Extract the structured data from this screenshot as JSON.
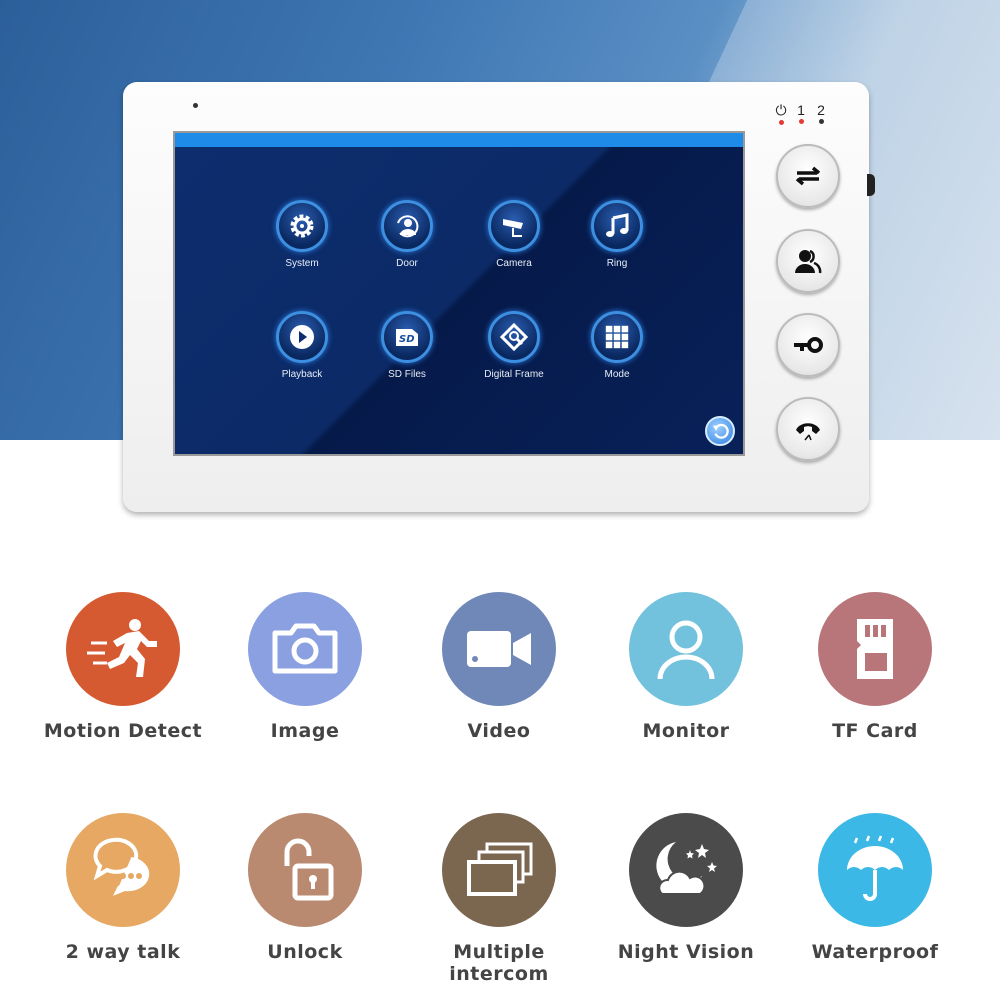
{
  "device": {
    "screen": {
      "apps": [
        {
          "label": "System",
          "icon": "gear-icon"
        },
        {
          "label": "Door",
          "icon": "door-user-icon"
        },
        {
          "label": "Camera",
          "icon": "cctv-camera-icon"
        },
        {
          "label": "Ring",
          "icon": "music-note-icon"
        },
        {
          "label": "Playback",
          "icon": "play-icon"
        },
        {
          "label": "SD Files",
          "icon": "sd-card-icon"
        },
        {
          "label": "Digital Frame",
          "icon": "picture-search-icon"
        },
        {
          "label": "Mode",
          "icon": "grid-icon"
        }
      ],
      "back_icon": "back-icon"
    },
    "indicators": [
      {
        "label": "⏻",
        "color": "#e53935"
      },
      {
        "label": "1",
        "color": "#e53935"
      },
      {
        "label": "2",
        "color": "#333333"
      }
    ],
    "buttons": [
      {
        "icon": "switch-arrows-icon"
      },
      {
        "icon": "monitor-users-icon"
      },
      {
        "icon": "unlock-key-icon"
      },
      {
        "icon": "hang-up-phone-icon"
      }
    ]
  },
  "features": [
    {
      "label": "Motion Detect",
      "color": "#d65a31",
      "icon": "running-man-icon"
    },
    {
      "label": "Image",
      "color": "#8ba0e0",
      "icon": "camera-icon"
    },
    {
      "label": "Video",
      "color": "#7088b8",
      "icon": "video-camera-icon"
    },
    {
      "label": "Monitor",
      "color": "#72c2dd",
      "icon": "person-icon"
    },
    {
      "label": "TF Card",
      "color": "#b8767a",
      "icon": "tf-card-icon"
    },
    {
      "label": "2 way talk",
      "color": "#e6a862",
      "icon": "chat-bubbles-icon"
    },
    {
      "label": "Unlock",
      "color": "#b98a70",
      "icon": "open-padlock-icon"
    },
    {
      "label": "Multiple intercom",
      "color": "#7b6650",
      "icon": "stacked-screens-icon"
    },
    {
      "label": "Night Vision",
      "color": "#4b4b4b",
      "icon": "moon-stars-icon"
    },
    {
      "label": "Waterproof",
      "color": "#3cb8e6",
      "icon": "umbrella-rain-icon"
    }
  ]
}
